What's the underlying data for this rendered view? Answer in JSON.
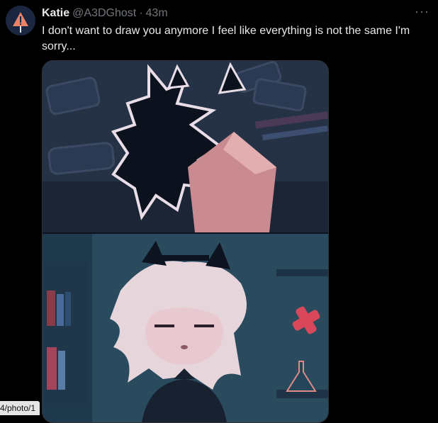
{
  "tweet": {
    "display_name": "Katie",
    "handle": "@A3DGhost",
    "separator": "·",
    "time": "43m",
    "more_label": "···",
    "text": "I don't want to draw you anymore I feel like everything is not the same I'm sorry..."
  },
  "status_bar": {
    "url": "4/photo/1"
  },
  "colors": {
    "background": "#000000",
    "text_primary": "#e7e9ea",
    "text_secondary": "#71767b"
  },
  "icons": {
    "avatar": "warning-sign-avatar",
    "more": "more-options-icon"
  }
}
